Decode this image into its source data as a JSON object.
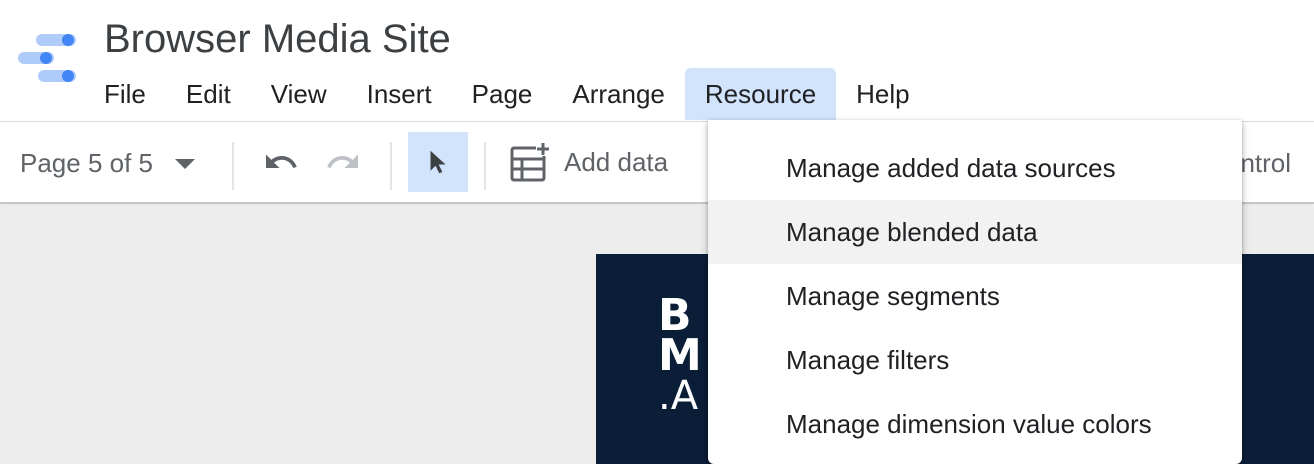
{
  "app": {
    "title": "Browser Media Site",
    "logo_icon": "data-studio-logo-icon"
  },
  "menubar": {
    "items": [
      "File",
      "Edit",
      "View",
      "Insert",
      "Page",
      "Arrange",
      "Resource",
      "Help"
    ],
    "active": "Resource"
  },
  "toolbar": {
    "page_indicator": "Page 5 of 5",
    "add_data_label": "Add data",
    "control_label": "ontrol",
    "icons": [
      "undo-icon",
      "redo-icon",
      "select-pointer-icon",
      "add-data-icon"
    ]
  },
  "resource_menu": {
    "items": [
      "Manage added data sources",
      "Manage blended data",
      "Manage segments",
      "Manage filters",
      "Manage dimension value colors"
    ],
    "hovered_index": 1
  },
  "report_page": {
    "brand_lines": [
      "B",
      "M",
      ".A"
    ]
  },
  "colors": {
    "accent": "#d2e3fc",
    "logo_blue_dark": "#4285f4",
    "logo_blue_light": "#aecbfa",
    "report_background": "#0b1e38",
    "canvas_background": "#ededed"
  }
}
